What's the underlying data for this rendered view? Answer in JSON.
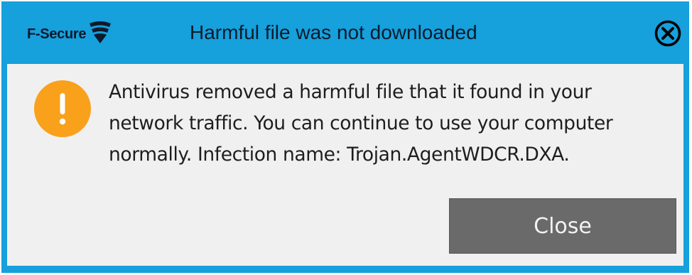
{
  "window": {
    "title": "Harmful file was not downloaded",
    "logo_text": "F-Secure",
    "logo_icon": "f-secure-shield-icon",
    "close_icon": "close-circle-icon"
  },
  "message": {
    "icon": "warning-exclamation-icon",
    "text": "Antivirus removed a harmful file that it found in your network traffic. You can continue to use your computer normally. Infection name: Trojan.AgentWDCR.DXA."
  },
  "actions": {
    "close_label": "Close"
  },
  "colors": {
    "accent": "#16a0dc",
    "background": "#f0f0f0",
    "warning": "#f9a11b",
    "button": "#6a6a6a",
    "button_text": "#f2f2f2"
  }
}
